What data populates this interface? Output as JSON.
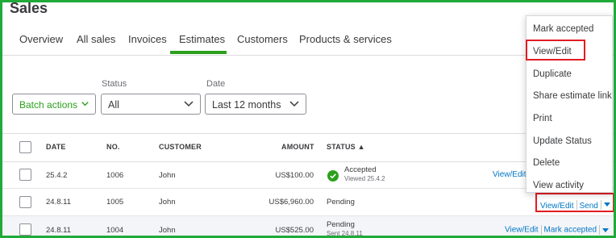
{
  "page": {
    "title": "Sales"
  },
  "tabs": [
    {
      "label": "Overview"
    },
    {
      "label": "All sales"
    },
    {
      "label": "Invoices"
    },
    {
      "label": "Estimates"
    },
    {
      "label": "Customers"
    },
    {
      "label": "Products & services"
    }
  ],
  "active_tab": "Estimates",
  "filters": {
    "batch_label": "Batch actions",
    "status_label": "Status",
    "status_value": "All",
    "date_label": "Date",
    "date_value": "Last 12 months"
  },
  "table": {
    "headers": {
      "date": "DATE",
      "no": "NO.",
      "customer": "CUSTOMER",
      "amount": "AMOUNT",
      "status": "STATUS ▲"
    },
    "rows": [
      {
        "date": "25.4.2",
        "no": "1006",
        "customer": "John",
        "amount": "US$100.00",
        "status": "Accepted",
        "status_sub": "Viewed 25.4.2",
        "action": "View/Edit"
      },
      {
        "date": "24.8.11",
        "no": "1005",
        "customer": "John",
        "amount": "US$6,960.00",
        "status": "Pending",
        "status_sub": "",
        "action": "View/Edit",
        "action2": "Send"
      },
      {
        "date": "24.8.11",
        "no": "1004",
        "customer": "John",
        "amount": "US$525.00",
        "status": "Pending",
        "status_sub": "Sent 24.8.11",
        "action": "View/Edit",
        "action2": "Mark accepted"
      }
    ]
  },
  "menu": {
    "items": [
      {
        "label": "Mark accepted"
      },
      {
        "label": "View/Edit"
      },
      {
        "label": "Duplicate"
      },
      {
        "label": "Share estimate link"
      },
      {
        "label": "Print"
      },
      {
        "label": "Update Status"
      },
      {
        "label": "Delete"
      },
      {
        "label": "View activity"
      }
    ]
  },
  "colors": {
    "brand_green": "#2ca01c",
    "link_blue": "#0077c5",
    "highlight_red": "#e21c23",
    "frame_green": "#1faa3a"
  }
}
